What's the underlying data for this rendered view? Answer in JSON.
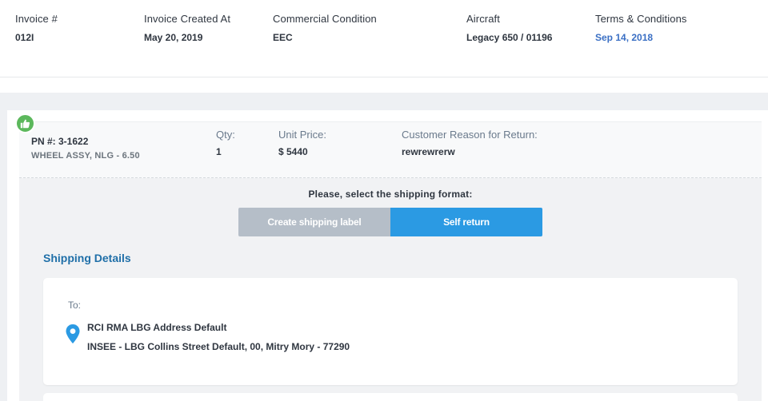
{
  "header": {
    "invoice_label": "Invoice #",
    "invoice_value": "012I",
    "created_label": "Invoice Created At",
    "created_value": "May 20, 2019",
    "condition_label": "Commercial Condition",
    "condition_value": "EEC",
    "aircraft_label": "Aircraft",
    "aircraft_value": "Legacy 650 / 01196",
    "terms_label": "Terms & Conditions",
    "terms_value": "Sep 14, 2018"
  },
  "item": {
    "badge_icon": "thumbs-up-icon",
    "badge_color": "#5cb85c",
    "pn": "PN #: 3-1622",
    "description": "WHEEL ASSY, NLG - 6.50",
    "qty_label": "Qty:",
    "qty_value": "1",
    "price_label": "Unit Price:",
    "price_value": "$ 5440",
    "reason_label": "Customer Reason for Return:",
    "reason_value": "rewrewrerw"
  },
  "shipping": {
    "prompt": "Please, select the shipping format:",
    "create_label_button": "Create shipping label",
    "self_return_button": "Self return",
    "details_title": "Shipping Details",
    "to_label": "To:",
    "pin_icon": "map-pin-icon",
    "address_name": "RCI RMA LBG Address Default",
    "address_line": "INSEE - LBG Collins Street Default, 00, Mitry Mory - 77290"
  },
  "colors": {
    "accent": "#2b9ae3",
    "link": "#3a6fc4",
    "disabled": "#b5bec8",
    "section_title": "#1f6fa8"
  }
}
